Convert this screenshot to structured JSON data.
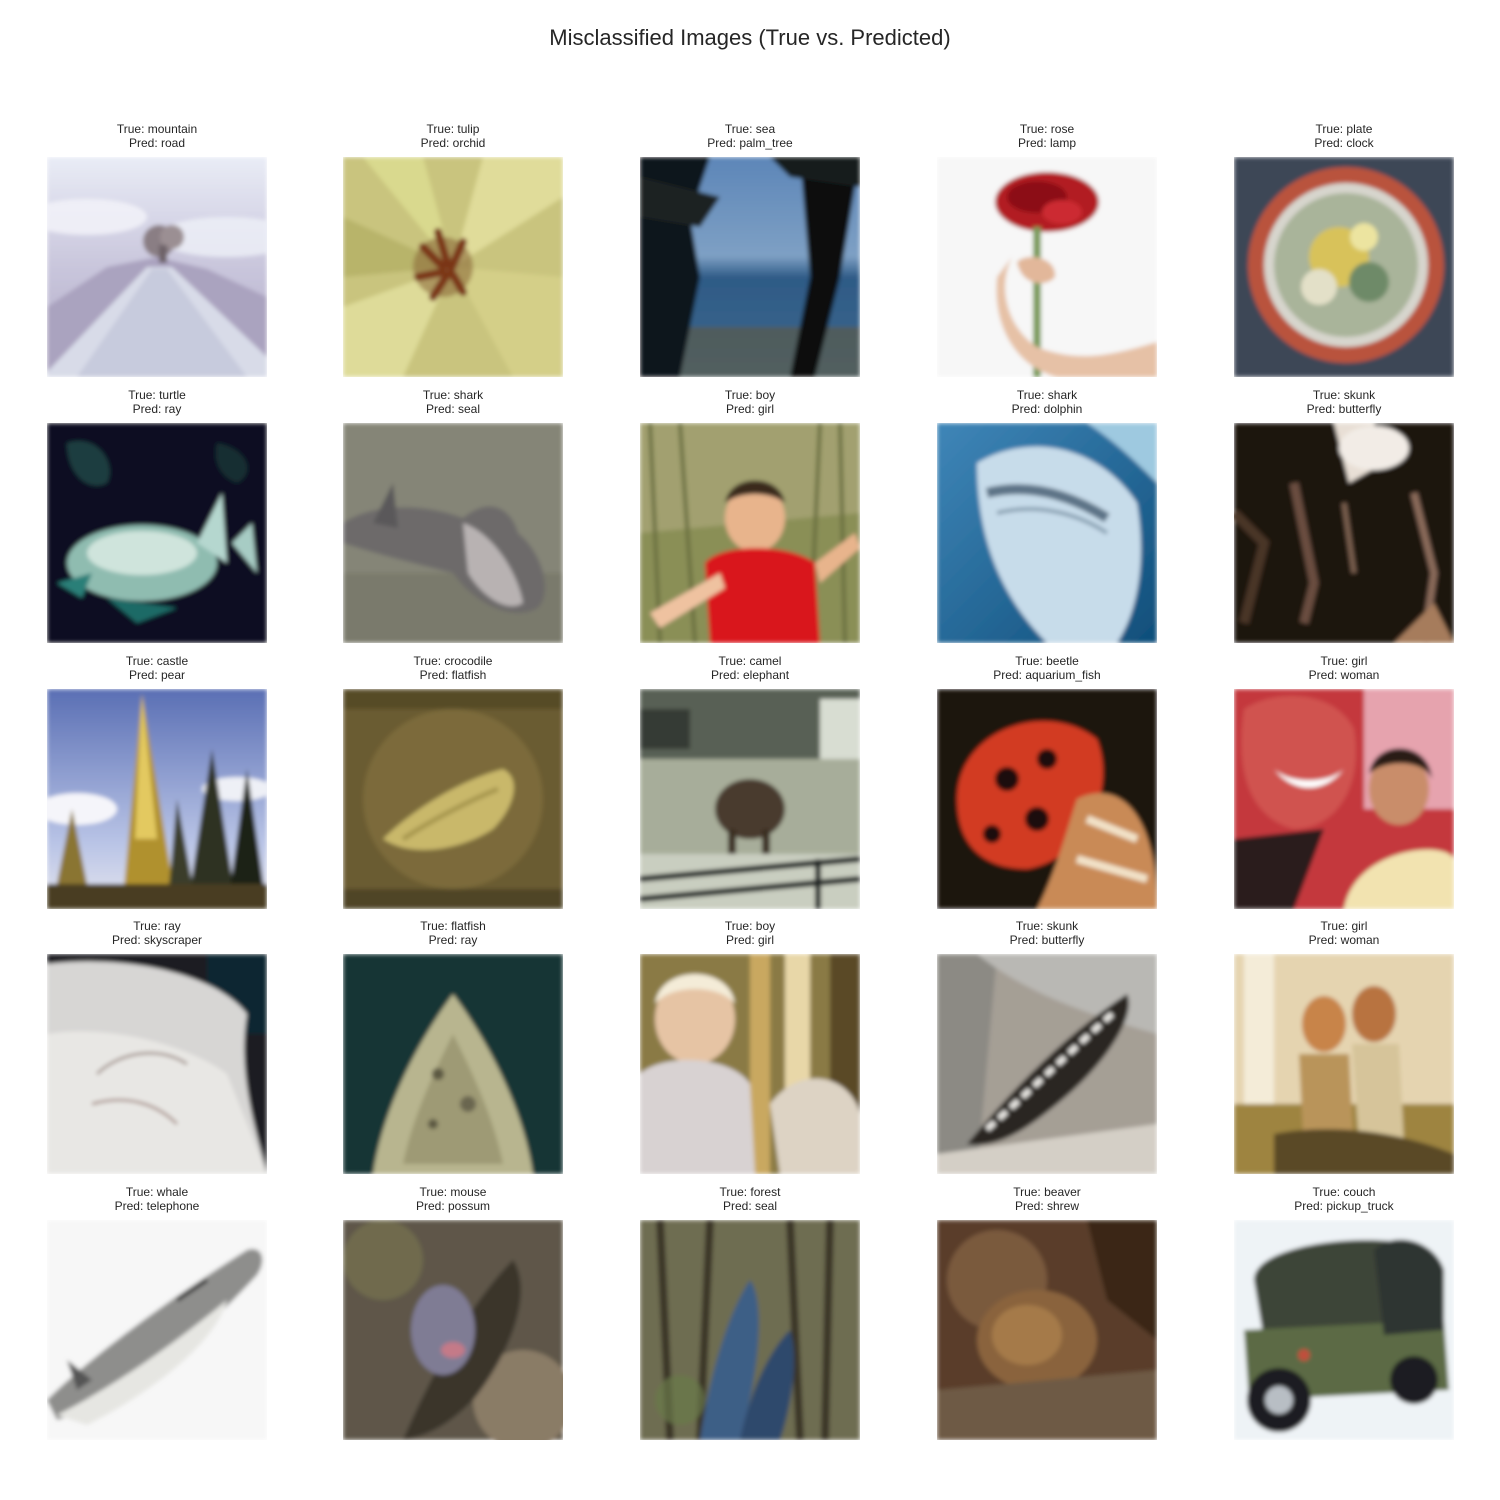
{
  "figure": {
    "title": "Misclassified Images (True vs. Predicted)"
  },
  "rows": [
    [
      {
        "true_label": "True: mountain",
        "pred_label": "Pred: road",
        "scene": "mountain"
      },
      {
        "true_label": "True: tulip",
        "pred_label": "Pred: orchid",
        "scene": "tulip"
      },
      {
        "true_label": "True: sea",
        "pred_label": "Pred: palm_tree",
        "scene": "sea"
      },
      {
        "true_label": "True: rose",
        "pred_label": "Pred: lamp",
        "scene": "rose"
      },
      {
        "true_label": "True: plate",
        "pred_label": "Pred: clock",
        "scene": "plate"
      }
    ],
    [
      {
        "true_label": "True: turtle",
        "pred_label": "Pred: ray",
        "scene": "turtle"
      },
      {
        "true_label": "True: shark",
        "pred_label": "Pred: seal",
        "scene": "shark_grey"
      },
      {
        "true_label": "True: boy",
        "pred_label": "Pred: girl",
        "scene": "boy_red"
      },
      {
        "true_label": "True: shark",
        "pred_label": "Pred: dolphin",
        "scene": "shark_blue"
      },
      {
        "true_label": "True: skunk",
        "pred_label": "Pred: butterfly",
        "scene": "skunk_dark"
      }
    ],
    [
      {
        "true_label": "True: castle",
        "pred_label": "Pred: pear",
        "scene": "castle"
      },
      {
        "true_label": "True: crocodile",
        "pred_label": "Pred: flatfish",
        "scene": "crocodile"
      },
      {
        "true_label": "True: camel",
        "pred_label": "Pred: elephant",
        "scene": "camel"
      },
      {
        "true_label": "True: beetle",
        "pred_label": "Pred: aquarium_fish",
        "scene": "beetle"
      },
      {
        "true_label": "True: girl",
        "pred_label": "Pred: woman",
        "scene": "girl_pink"
      }
    ],
    [
      {
        "true_label": "True: ray",
        "pred_label": "Pred: skyscraper",
        "scene": "ray"
      },
      {
        "true_label": "True: flatfish",
        "pred_label": "Pred: ray",
        "scene": "flatfish"
      },
      {
        "true_label": "True: boy",
        "pred_label": "Pred: girl",
        "scene": "boy_blond"
      },
      {
        "true_label": "True: skunk",
        "pred_label": "Pred: butterfly",
        "scene": "skunk_rock"
      },
      {
        "true_label": "True: girl",
        "pred_label": "Pred: woman",
        "scene": "girl_tan"
      }
    ],
    [
      {
        "true_label": "True: whale",
        "pred_label": "Pred: telephone",
        "scene": "whale"
      },
      {
        "true_label": "True: mouse",
        "pred_label": "Pred: possum",
        "scene": "mouse"
      },
      {
        "true_label": "True: forest",
        "pred_label": "Pred: seal",
        "scene": "forest"
      },
      {
        "true_label": "True: beaver",
        "pred_label": "Pred: shrew",
        "scene": "beaver"
      },
      {
        "true_label": "True: couch",
        "pred_label": "Pred: pickup_truck",
        "scene": "couch"
      }
    ]
  ]
}
